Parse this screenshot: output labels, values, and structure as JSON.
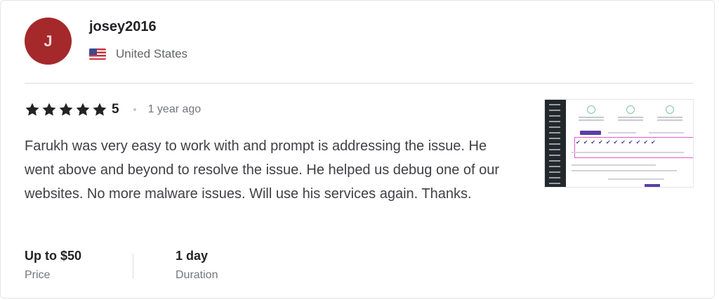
{
  "reviewer": {
    "avatar_initial": "J",
    "avatar_color": "#a5282a",
    "username": "josey2016",
    "country": "United States",
    "flag_icon": "us-flag-icon"
  },
  "rating": {
    "stars": 5,
    "value": "5",
    "time_ago": "1 year ago",
    "star_color": "#222325"
  },
  "review": {
    "text": "Farukh was very easy to work with and prompt is addressing the issue. He went above and beyond to resolve the issue. He helped us debug one of our websites. No more malware issues. Will use his services again. Thanks."
  },
  "stats": {
    "price_value": "Up to $50",
    "price_label": "Price",
    "duration_value": "1 day",
    "duration_label": "Duration"
  },
  "thumbnail": {
    "description_icon": "dashboard-screenshot-thumbnail"
  }
}
